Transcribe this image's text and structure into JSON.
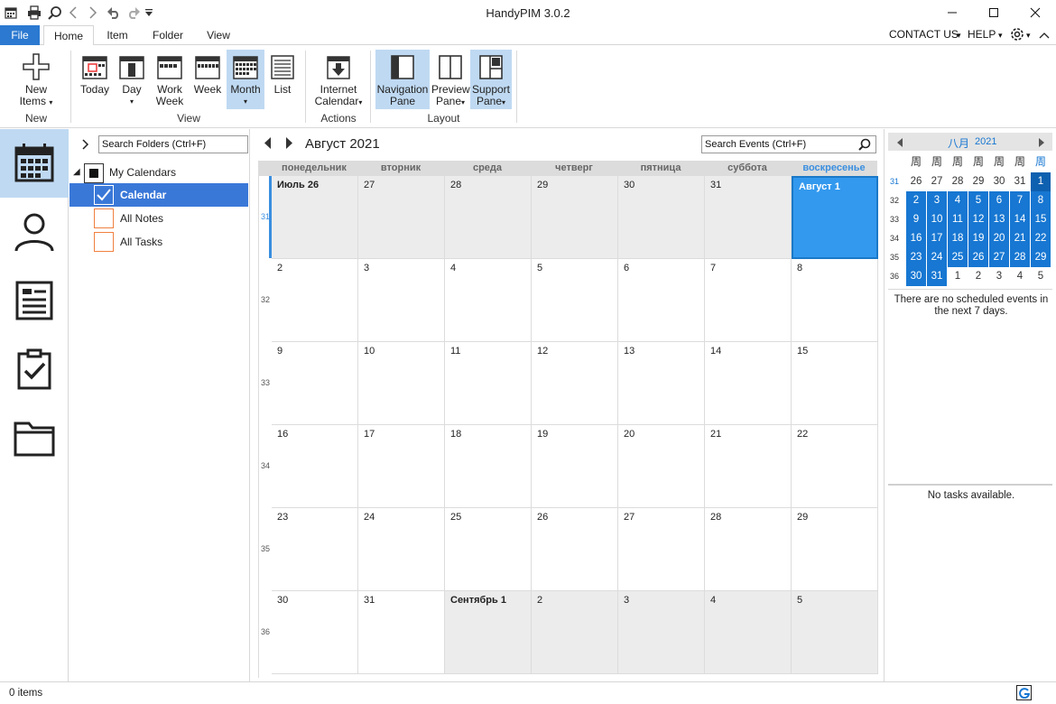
{
  "app": {
    "title": "HandyPIM 3.0.2"
  },
  "tabs": {
    "file": "File",
    "home": "Home",
    "item": "Item",
    "folder": "Folder",
    "view": "View"
  },
  "header_links": {
    "contact": "CONTACT US",
    "help": "HELP"
  },
  "ribbon": {
    "new_items": [
      "New",
      "Items"
    ],
    "today": "Today",
    "day": "Day",
    "work_week": [
      "Work",
      "Week"
    ],
    "week": "Week",
    "month": "Month",
    "list": "List",
    "internet_calendar": [
      "Internet",
      "Calendar"
    ],
    "navigation_pane": [
      "Navigation",
      "Pane"
    ],
    "preview_pane": [
      "Preview",
      "Pane"
    ],
    "support_pane": [
      "Support",
      "Pane"
    ],
    "groups": {
      "new": "New",
      "view": "View",
      "actions": "Actions",
      "layout": "Layout"
    }
  },
  "folders": {
    "search_placeholder": "Search Folders (Ctrl+F)",
    "root": "My Calendars",
    "items": [
      {
        "label": "Calendar",
        "checked": true,
        "selected": true
      },
      {
        "label": "All Notes",
        "checked": false,
        "selected": false
      },
      {
        "label": "All Tasks",
        "checked": false,
        "selected": false
      }
    ]
  },
  "calendar": {
    "title": "Август 2021",
    "search_placeholder": "Search Events (Ctrl+F)",
    "days_of_week": [
      "понедельник",
      "вторник",
      "среда",
      "четверг",
      "пятница",
      "суббота",
      "воскресенье"
    ],
    "weeks": [
      {
        "num": "31",
        "days": [
          "Июль 26",
          "27",
          "28",
          "29",
          "30",
          "31",
          "Август 1"
        ]
      },
      {
        "num": "32",
        "days": [
          "2",
          "3",
          "4",
          "5",
          "6",
          "7",
          "8"
        ]
      },
      {
        "num": "33",
        "days": [
          "9",
          "10",
          "11",
          "12",
          "13",
          "14",
          "15"
        ]
      },
      {
        "num": "34",
        "days": [
          "16",
          "17",
          "18",
          "19",
          "20",
          "21",
          "22"
        ]
      },
      {
        "num": "35",
        "days": [
          "23",
          "24",
          "25",
          "26",
          "27",
          "28",
          "29"
        ]
      },
      {
        "num": "36",
        "days": [
          "30",
          "31",
          "Сентябрь 1",
          "2",
          "3",
          "4",
          "5"
        ]
      }
    ]
  },
  "mini_calendar": {
    "month": "八月",
    "year": "2021",
    "day_headers": [
      "周",
      "周",
      "周",
      "周",
      "周",
      "周",
      "周"
    ],
    "weeks": [
      {
        "num": "31",
        "days": [
          "26",
          "27",
          "28",
          "29",
          "30",
          "31",
          "1"
        ]
      },
      {
        "num": "32",
        "days": [
          "2",
          "3",
          "4",
          "5",
          "6",
          "7",
          "8"
        ]
      },
      {
        "num": "33",
        "days": [
          "9",
          "10",
          "11",
          "12",
          "13",
          "14",
          "15"
        ]
      },
      {
        "num": "34",
        "days": [
          "16",
          "17",
          "18",
          "19",
          "20",
          "21",
          "22"
        ]
      },
      {
        "num": "35",
        "days": [
          "23",
          "24",
          "25",
          "26",
          "27",
          "28",
          "29"
        ]
      },
      {
        "num": "36",
        "days": [
          "30",
          "31",
          "1",
          "2",
          "3",
          "4",
          "5"
        ]
      }
    ]
  },
  "events_message": "There are no scheduled events in the next 7 days.",
  "tasks_message": "No tasks available.",
  "status": {
    "items": "0 items"
  },
  "colors": {
    "accent": "#2b79d0",
    "selection": "#bfd9f2",
    "today": "#3399ee",
    "mini_selected": "#1777d2"
  }
}
